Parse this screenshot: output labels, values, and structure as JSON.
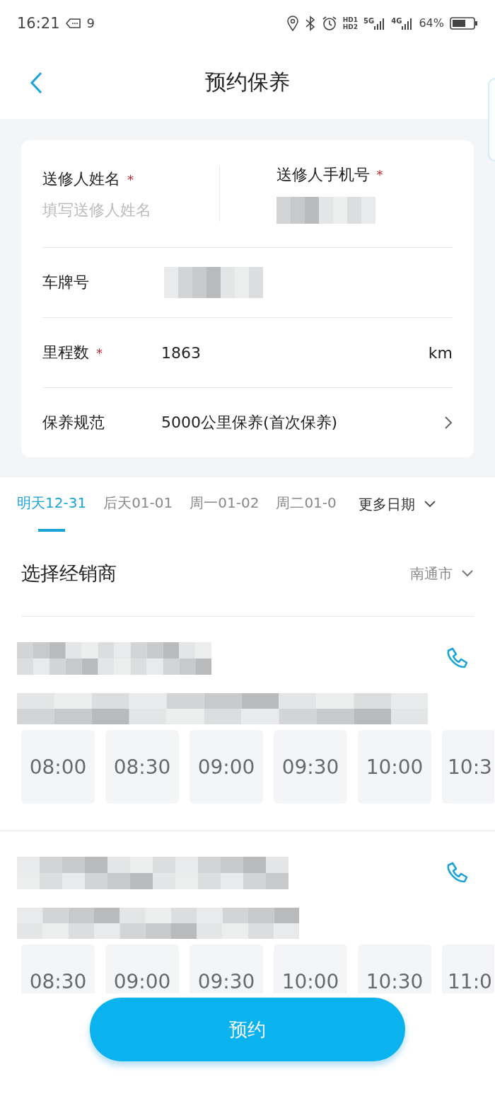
{
  "status_bar": {
    "time": "16:21",
    "notifications": "9",
    "hd_labels": [
      "HD1",
      "HD2"
    ],
    "networks": [
      "5G",
      "4G"
    ],
    "battery": "64%"
  },
  "header": {
    "title": "预约保养"
  },
  "form": {
    "contact": [
      {
        "label": "送修人姓名",
        "required_mark": "*",
        "placeholder": "填写送修人姓名"
      },
      {
        "label": "送修人手机号",
        "required_mark": "*",
        "redacted": true
      }
    ],
    "rows": [
      {
        "kind": "redacted",
        "label": "车牌号"
      },
      {
        "kind": "input",
        "label": "里程数",
        "required_mark": "*",
        "value": "1863",
        "unit": "km"
      },
      {
        "kind": "select",
        "label": "保养规范",
        "value": "5000公里保养(首次保养)"
      }
    ]
  },
  "date_tabs": [
    {
      "label": "明天12-31",
      "selected": true
    },
    {
      "label": "后天01-01",
      "selected": false
    },
    {
      "label": "周一01-02",
      "selected": false
    },
    {
      "label": "周二01-0",
      "selected": false
    }
  ],
  "more_dates": "更多日期",
  "dealer_section": {
    "title": "选择经销商",
    "city": "南通市"
  },
  "dealers": [
    {
      "slots": [
        "08:00",
        "08:30",
        "09:00",
        "09:30",
        "10:00",
        "10:3"
      ]
    },
    {
      "slots": [
        "08:30",
        "09:00",
        "09:30",
        "10:00",
        "10:30",
        "11:0"
      ]
    }
  ],
  "submit": "预约"
}
